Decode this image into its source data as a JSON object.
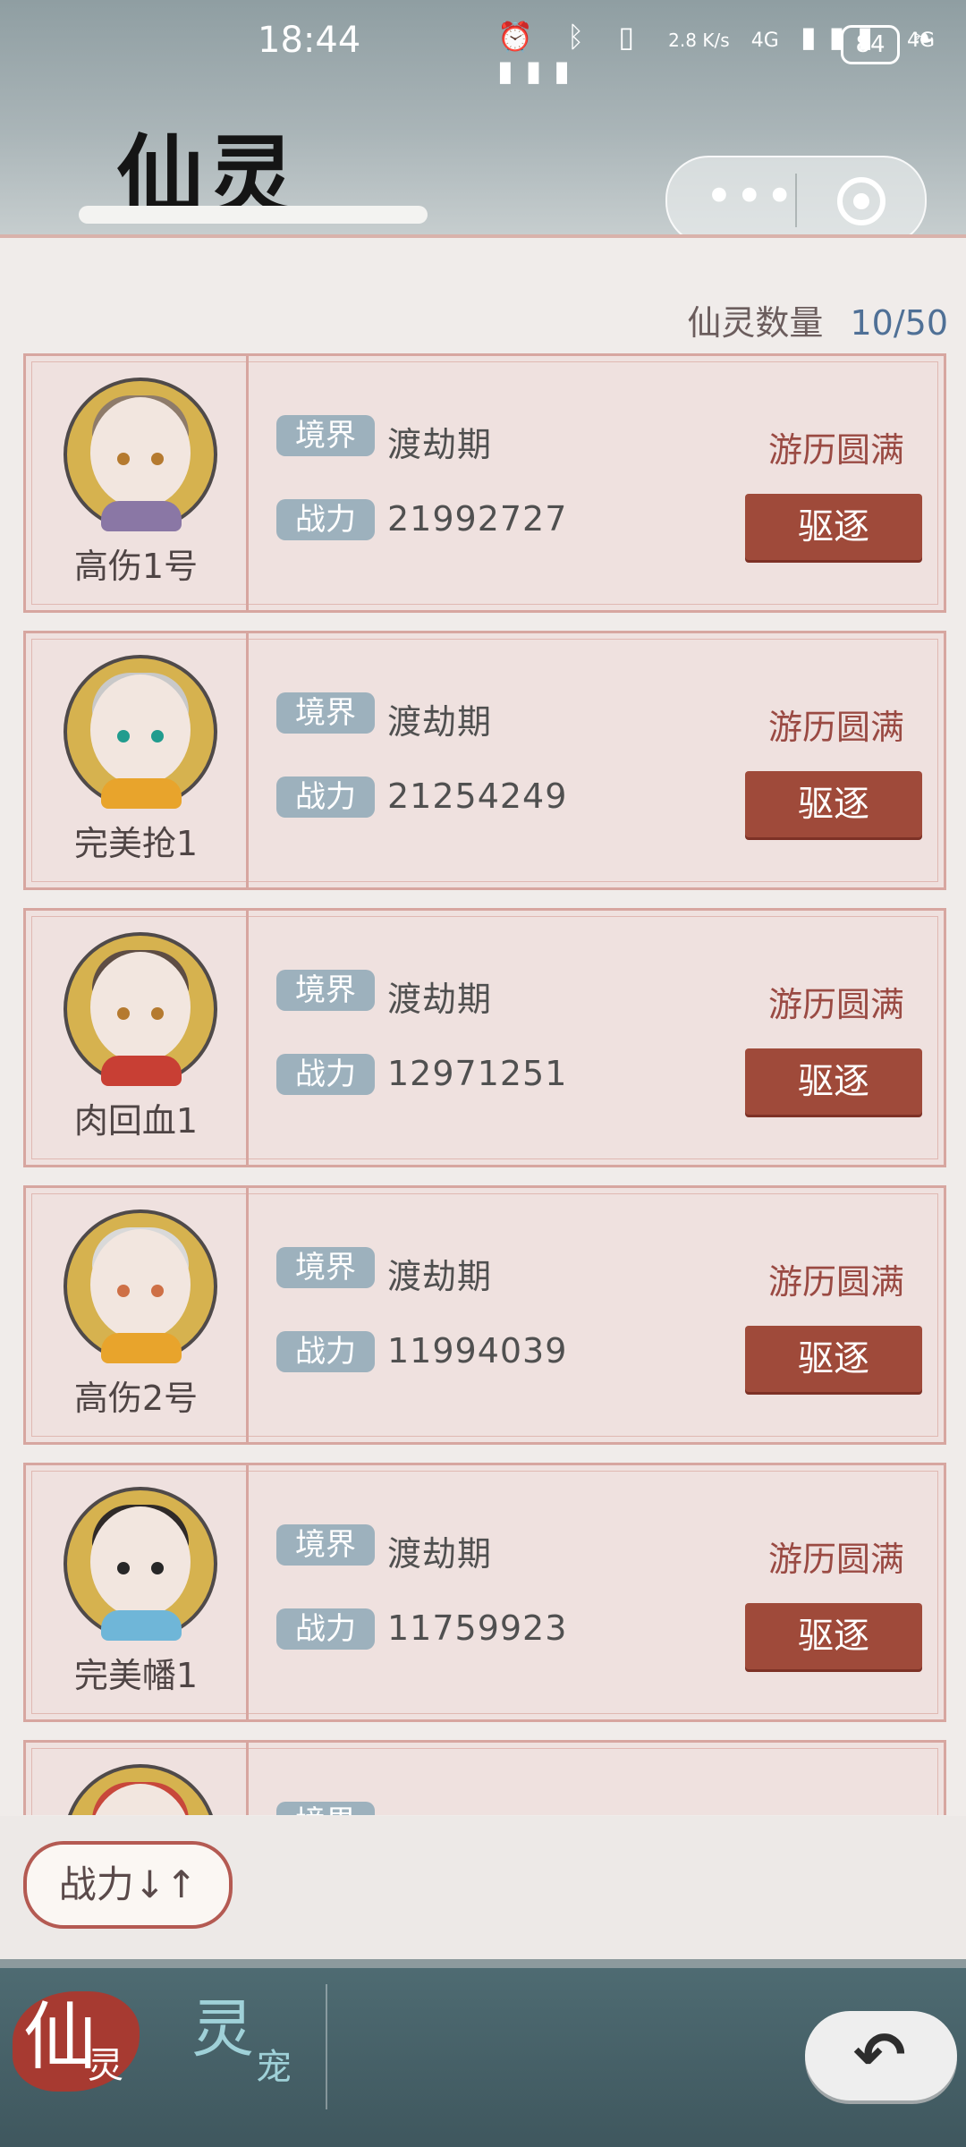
{
  "status_bar": {
    "time": "18:44",
    "network": "2.8 K/s",
    "signal_1": "4G",
    "signal_2": "4G",
    "battery": "84"
  },
  "header": {
    "title": "仙灵",
    "menu_icon": "dots-icon",
    "target_icon": "target-icon"
  },
  "summary": {
    "label": "仙灵数量",
    "value": "10/50"
  },
  "labels": {
    "realm": "境界",
    "power": "战力",
    "status": "游历圆满",
    "expel": "驱逐"
  },
  "items": [
    {
      "name": "高伤1号",
      "realm": "渡劫期",
      "power": "21992727",
      "status": "游历圆满",
      "expel": "驱逐"
    },
    {
      "name": "完美抢1",
      "realm": "渡劫期",
      "power": "21254249",
      "status": "游历圆满",
      "expel": "驱逐"
    },
    {
      "name": "肉回血1",
      "realm": "渡劫期",
      "power": "12971251",
      "status": "游历圆满",
      "expel": "驱逐"
    },
    {
      "name": "高伤2号",
      "realm": "渡劫期",
      "power": "11994039",
      "status": "游历圆满",
      "expel": "驱逐"
    },
    {
      "name": "完美幡1",
      "realm": "渡劫期",
      "power": "11759923",
      "status": "游历圆满",
      "expel": "驱逐"
    },
    {
      "name": "",
      "realm": "",
      "power": "",
      "status": "",
      "expel": ""
    }
  ],
  "sort": {
    "label": "战力↓↑"
  },
  "tabs": {
    "xian": {
      "main": "仙",
      "sub": "灵"
    },
    "ling": {
      "main": "灵",
      "sub": "宠"
    }
  },
  "colors": {
    "accent": "#9f4a3a",
    "tag_bg": "#9db1bd",
    "bottom_bar": "#46626a"
  }
}
